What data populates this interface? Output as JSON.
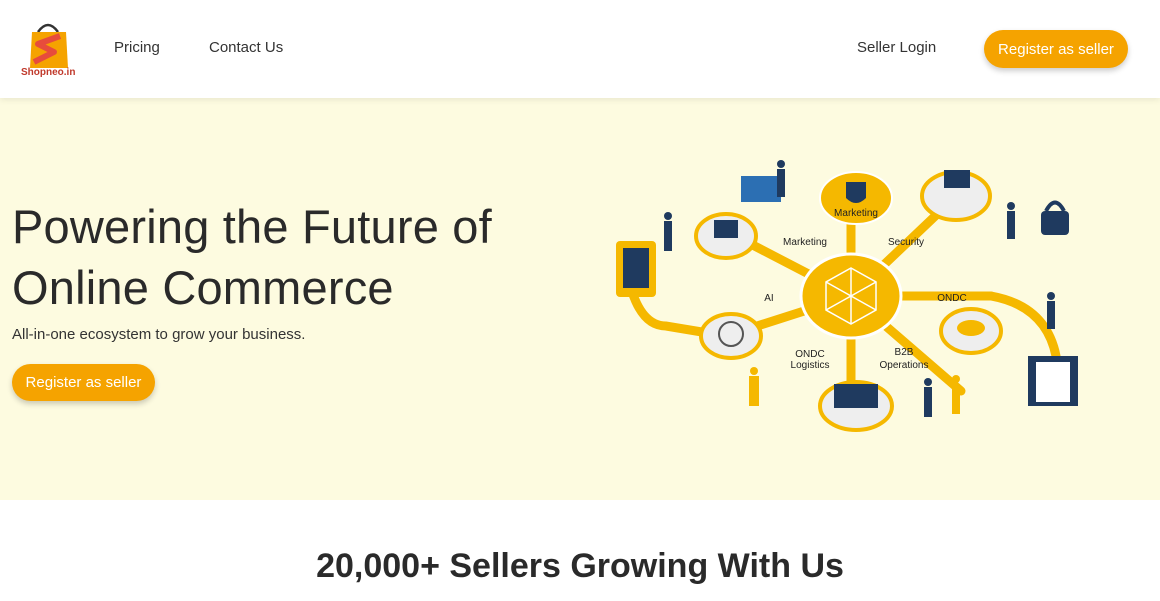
{
  "brand": {
    "name": "Shopneo.in"
  },
  "nav": {
    "pricing": "Pricing",
    "contact": "Contact Us",
    "login": "Seller Login",
    "register": "Register as seller"
  },
  "hero": {
    "title": "Powering the Future of Online Commerce",
    "subtitle": "All-in-one ecosystem to grow your business.",
    "cta": "Register as seller",
    "illustration_labels": {
      "marketing_top": "Marketing",
      "marketing": "Marketing",
      "security": "Security",
      "ai": "AI",
      "ondc": "ONDC",
      "ondc_logistics_1": "ONDC",
      "ondc_logistics_2": "Logistics",
      "b2b_1": "B2B",
      "b2b_2": "Operations"
    }
  },
  "sellers": {
    "heading": "20,000+ Sellers Growing With Us"
  },
  "colors": {
    "accent": "#f5a300",
    "hero_bg": "#fdfbe0",
    "text": "#2a2a2a"
  }
}
